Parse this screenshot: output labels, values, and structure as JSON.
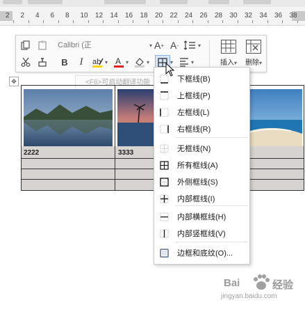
{
  "ruler": {
    "numbers": [
      "2",
      "2",
      "4",
      "6",
      "8",
      "10",
      "12",
      "14",
      "16",
      "18",
      "20",
      "22",
      "24",
      "26",
      "28",
      "30",
      "32",
      "34",
      "36",
      "38"
    ]
  },
  "toolbar": {
    "font_name": "Calibri (正",
    "insert_label": "插入",
    "delete_label": "删除",
    "bold": "B",
    "italic": "I",
    "font_color_letter": "A",
    "grow_font": "A⁺",
    "shrink_font": "A⁻"
  },
  "hint": "<F6>可启动翻译功能",
  "table": {
    "cells": [
      "2222",
      "3333"
    ]
  },
  "border_menu": {
    "items": [
      {
        "label": "下框线(B)",
        "icon": "bottom-border-icon"
      },
      {
        "label": "上框线(P)",
        "icon": "top-border-icon"
      },
      {
        "label": "左框线(L)",
        "icon": "left-border-icon"
      },
      {
        "label": "右框线(R)",
        "icon": "right-border-icon"
      },
      {
        "label": "无框线(N)",
        "icon": "no-border-icon"
      },
      {
        "label": "所有框线(A)",
        "icon": "all-borders-icon"
      },
      {
        "label": "外侧框线(S)",
        "icon": "outside-borders-icon"
      },
      {
        "label": "内部框线(I)",
        "icon": "inside-borders-icon"
      },
      {
        "label": "内部横框线(H)",
        "icon": "inside-horizontal-border-icon"
      },
      {
        "label": "内部竖框线(V)",
        "icon": "inside-vertical-border-icon"
      },
      {
        "label": "边框和底纹(O)...",
        "icon": "borders-shading-icon"
      }
    ]
  },
  "watermark": {
    "text": "Bai 经验",
    "url": "jingyan.baidu.com"
  },
  "colors": {
    "font_color_bar": "#e02020",
    "highlight_bar": "#ffd400",
    "menu_icon_border": "#5b6f8c",
    "table_fill": "#d6d3d0"
  }
}
